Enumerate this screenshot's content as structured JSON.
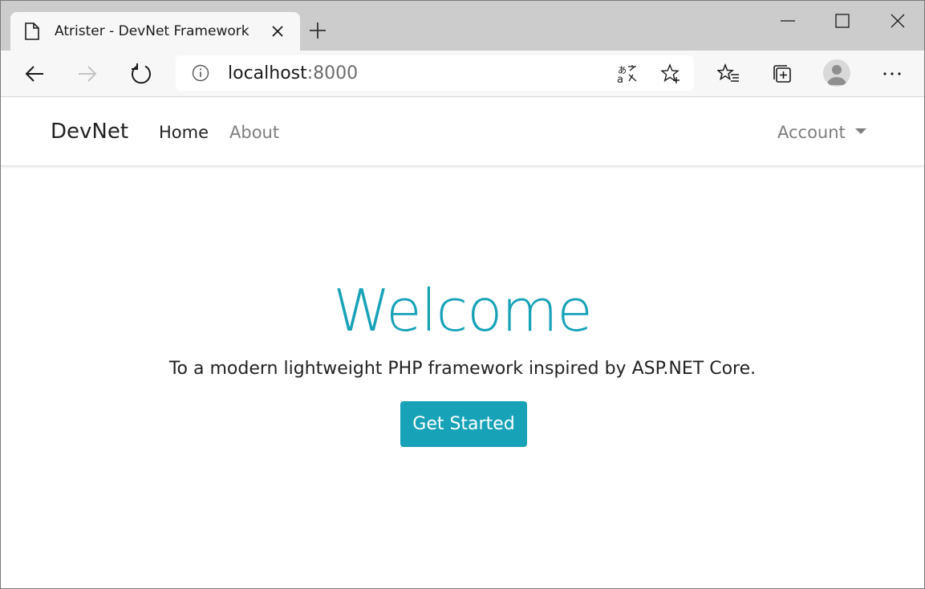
{
  "browser": {
    "tab_title": "Atrister - DevNet Framework",
    "url_host": "localhost",
    "url_port": ":8000",
    "icons": {
      "tab": "document-icon",
      "tab_close": "close-icon",
      "new_tab": "plus-icon",
      "minimize": "minimize-icon",
      "maximize": "maximize-icon",
      "close_window": "close-icon",
      "back": "arrow-left-icon",
      "forward": "arrow-right-icon",
      "refresh": "refresh-icon",
      "info": "info-icon",
      "translate": "translate-icon",
      "favorite": "star-add-icon",
      "favorites": "favorites-list-icon",
      "collections": "collections-icon",
      "profile": "avatar",
      "menu": "more-icon"
    }
  },
  "navbar": {
    "brand": "DevNet",
    "links": [
      {
        "label": "Home",
        "active": true
      },
      {
        "label": "About",
        "active": false
      }
    ],
    "account": "Account"
  },
  "hero": {
    "title": "Welcome",
    "subtitle": "To a modern lightweight PHP framework inspired by ASP.NET Core.",
    "button_label": "Get Started"
  },
  "colors": {
    "accent": "#17a2b8",
    "tabstrip": "#cccccc",
    "toolbar": "#f7f7f7"
  }
}
